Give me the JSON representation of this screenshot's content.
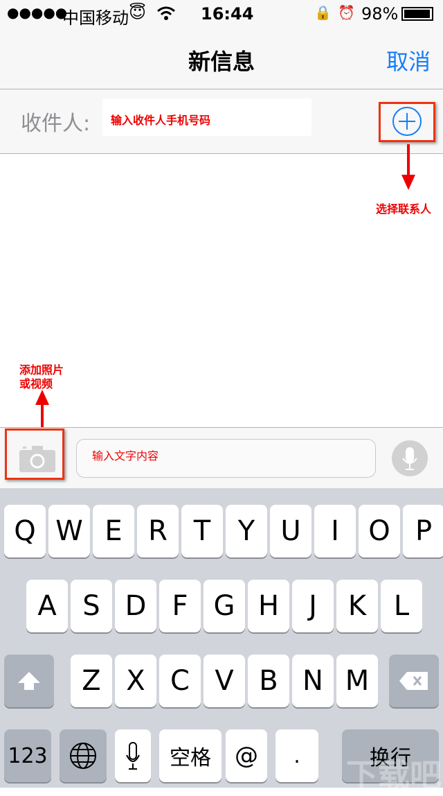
{
  "status": {
    "signal": "●●●●●",
    "carrier": "中国移动",
    "emoji": "😇",
    "time": "16:44",
    "battery": "98%"
  },
  "nav": {
    "title": "新信息",
    "cancel": "取消"
  },
  "recipient": {
    "label": "收件人:",
    "placeholder": "输入收件人手机号码"
  },
  "compose": {
    "placeholder": "输入文字内容"
  },
  "annotations": {
    "contacts": "选择联系人",
    "photo_line1": "添加照片",
    "photo_line2": "或视频",
    "accent": "#e00000"
  },
  "keyboard": {
    "row1": [
      "Q",
      "W",
      "E",
      "R",
      "T",
      "Y",
      "U",
      "I",
      "O",
      "P"
    ],
    "row2": [
      "A",
      "S",
      "D",
      "F",
      "G",
      "H",
      "J",
      "K",
      "L"
    ],
    "row3": [
      "Z",
      "X",
      "C",
      "V",
      "B",
      "N",
      "M"
    ],
    "numbers": "123",
    "space": "空格",
    "at": "@",
    "dot": ".",
    "return": "换行"
  },
  "watermark": "下载吧"
}
